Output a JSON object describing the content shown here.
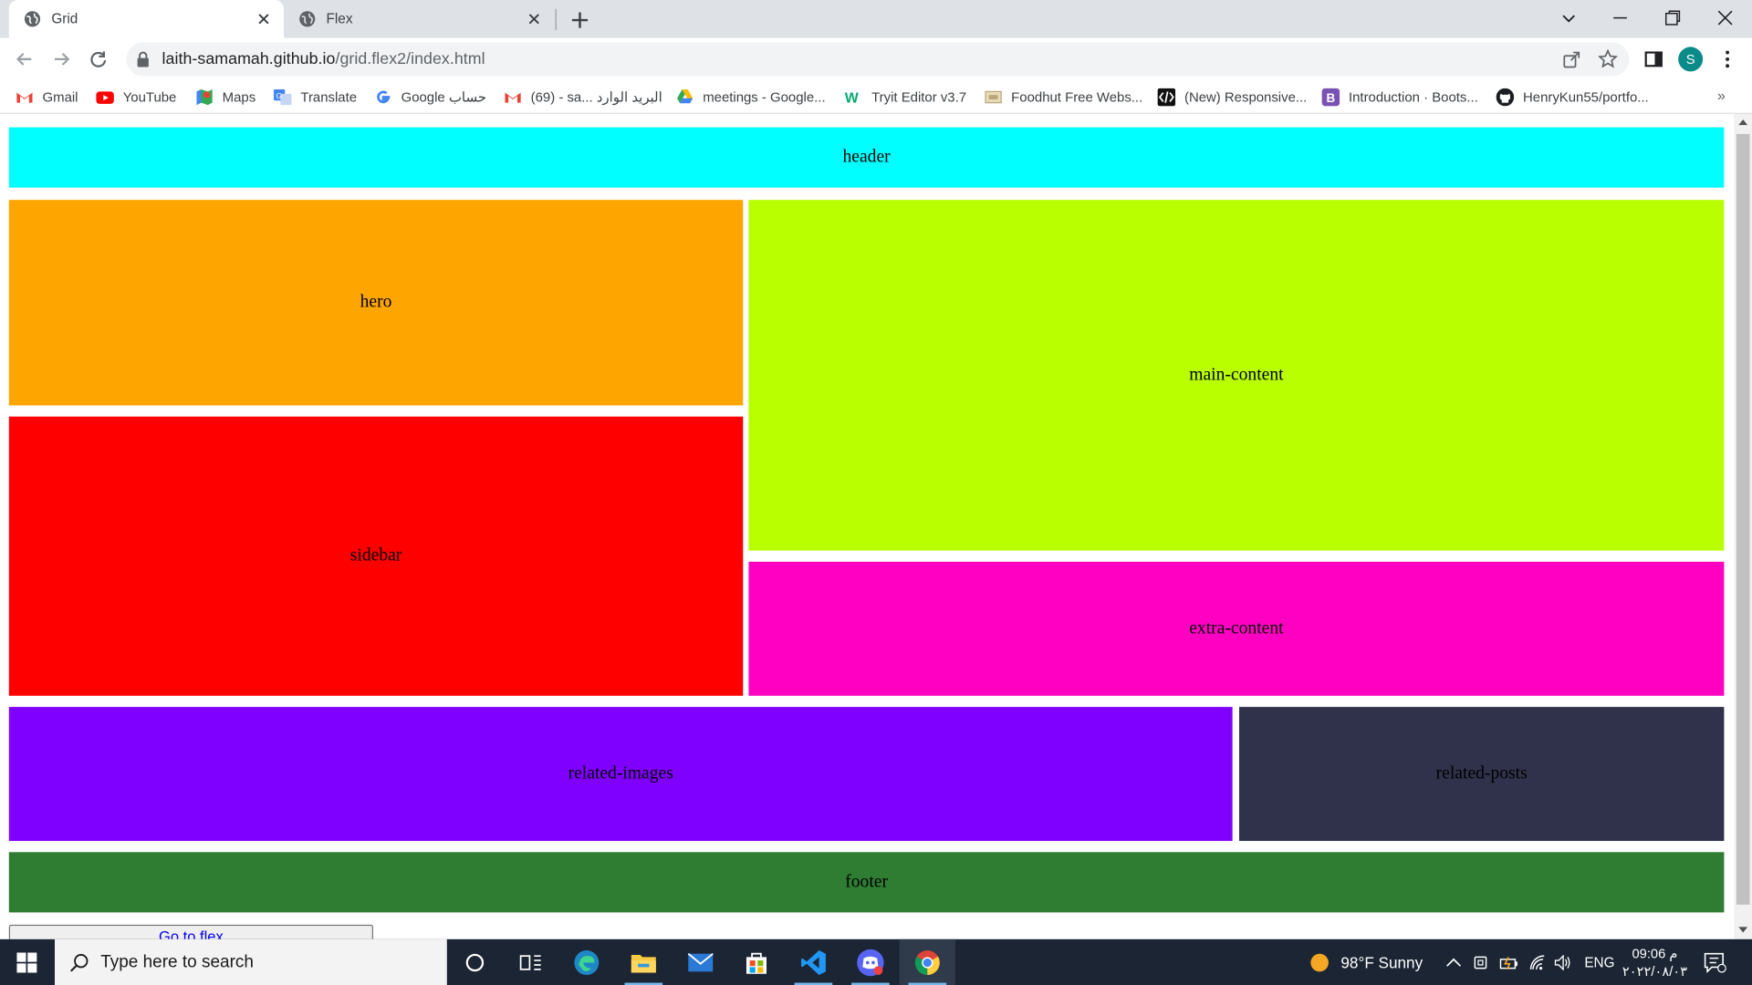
{
  "browser": {
    "tabs": [
      {
        "title": "Grid",
        "active": true
      },
      {
        "title": "Flex",
        "active": false
      }
    ],
    "address": {
      "domain": "laith-samamah.github.io",
      "path": "/grid.flex2/index.html"
    },
    "profile_initial": "S",
    "bookmarks": [
      {
        "label": "Gmail",
        "icon": "gmail-icon"
      },
      {
        "label": "YouTube",
        "icon": "youtube-icon"
      },
      {
        "label": "Maps",
        "icon": "maps-icon"
      },
      {
        "label": "Translate",
        "icon": "translate-icon"
      },
      {
        "label": "Google حساب",
        "icon": "google-icon"
      },
      {
        "label": "(69) - sa... البريد الوارد",
        "icon": "gmail-icon"
      },
      {
        "label": "meetings - Google...",
        "icon": "drive-icon"
      },
      {
        "label": "Tryit Editor v3.7",
        "icon": "w3schools-icon"
      },
      {
        "label": "Foodhut Free Webs...",
        "icon": "foodhut-icon"
      },
      {
        "label": "(New) Responsive...",
        "icon": "codepen-icon"
      },
      {
        "label": "Introduction · Boots...",
        "icon": "bootstrap-icon"
      },
      {
        "label": "HenryKun55/portfo...",
        "icon": "github-icon"
      }
    ]
  },
  "page": {
    "areas": [
      {
        "name": "header",
        "label": "header",
        "color": "#00ffff"
      },
      {
        "name": "hero",
        "label": "hero",
        "color": "#ffa500"
      },
      {
        "name": "main-content",
        "label": "main-content",
        "color": "#b9ff00"
      },
      {
        "name": "sidebar",
        "label": "sidebar",
        "color": "#ff0000"
      },
      {
        "name": "extra-content",
        "label": "extra-content",
        "color": "#ff00c3"
      },
      {
        "name": "related-images",
        "label": "related-images",
        "color": "#8000ff"
      },
      {
        "name": "related-posts",
        "label": "related-posts",
        "color": "#2f324a"
      },
      {
        "name": "footer",
        "label": "footer",
        "color": "#2e7d32"
      }
    ],
    "go_to_flex": "Go to flex"
  },
  "taskbar": {
    "search_placeholder": "Type here to search",
    "weather": "98°F  Sunny",
    "language": "ENG",
    "time": "09:06 م",
    "date": "٢٠٢٢/٠٨/٠٣"
  }
}
